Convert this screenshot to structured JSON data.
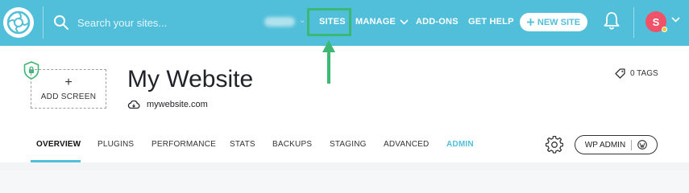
{
  "search": {
    "placeholder": "Search your sites..."
  },
  "nav": {
    "sites": "SITES",
    "manage": "MANAGE",
    "addons": "ADD-ONS",
    "help": "GET HELP",
    "new_site": "NEW SITE"
  },
  "user": {
    "initial": "S"
  },
  "site": {
    "title": "My Website",
    "url": "mywebsite.com",
    "tags": "0 TAGS"
  },
  "add_screen": {
    "label": "ADD SCREEN"
  },
  "tabs": [
    {
      "label": "OVERVIEW"
    },
    {
      "label": "PLUGINS"
    },
    {
      "label": "PERFORMANCE"
    },
    {
      "label": "STATS"
    },
    {
      "label": "BACKUPS"
    },
    {
      "label": "STAGING"
    },
    {
      "label": "ADVANCED"
    },
    {
      "label": "ADMIN"
    }
  ],
  "wp_admin": {
    "label": "WP ADMIN"
  },
  "colors": {
    "brand": "#51bfd9",
    "highlight": "#3cb774",
    "avatar": "#f05268",
    "avatar_status": "#f4c430"
  },
  "icons": [
    "flywheel-logo-icon",
    "search-icon",
    "chevron-down-icon",
    "plus-icon",
    "bell-icon",
    "shield-icon",
    "cloud-icon",
    "tag-icon",
    "gear-icon",
    "wordpress-icon",
    "arrow-up-icon"
  ]
}
